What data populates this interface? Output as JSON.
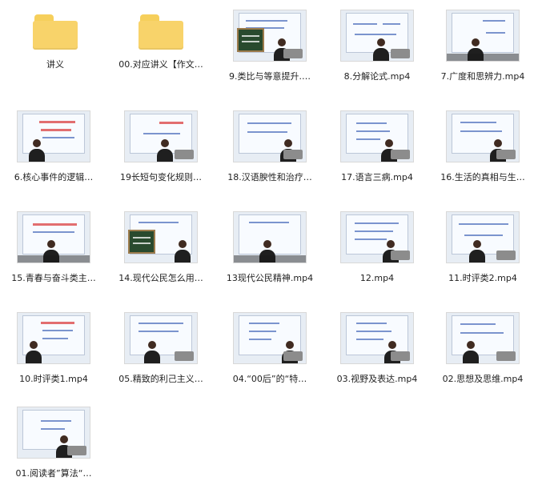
{
  "grid": {
    "items": [
      {
        "label": "讲义",
        "type": "folder",
        "icon": "folder-icon"
      },
      {
        "label": "00.对应讲义【作文…",
        "type": "folder",
        "icon": "folder-icon"
      },
      {
        "label": "9.类比与等意提升.…",
        "type": "video",
        "icon": "video-thumbnail"
      },
      {
        "label": "8.分解论式.mp4",
        "type": "video",
        "icon": "video-thumbnail"
      },
      {
        "label": "7.广度和思辨力.mp4",
        "type": "video",
        "icon": "video-thumbnail"
      },
      {
        "label": "6.核心事件的逻辑…",
        "type": "video",
        "icon": "video-thumbnail"
      },
      {
        "label": "19长短句变化规则…",
        "type": "video",
        "icon": "video-thumbnail"
      },
      {
        "label": "18.汉语腴性和治疗…",
        "type": "video",
        "icon": "video-thumbnail"
      },
      {
        "label": "17.语言三病.mp4",
        "type": "video",
        "icon": "video-thumbnail"
      },
      {
        "label": "16.生活的真相与生…",
        "type": "video",
        "icon": "video-thumbnail"
      },
      {
        "label": "15.青春与奋斗类主…",
        "type": "video",
        "icon": "video-thumbnail"
      },
      {
        "label": "14.现代公民怎么用…",
        "type": "video",
        "icon": "video-thumbnail"
      },
      {
        "label": "13现代公民精神.mp4",
        "type": "video",
        "icon": "video-thumbnail"
      },
      {
        "label": "12.mp4",
        "type": "video",
        "icon": "video-thumbnail"
      },
      {
        "label": "11.时评类2.mp4",
        "type": "video",
        "icon": "video-thumbnail"
      },
      {
        "label": "10.时评类1.mp4",
        "type": "video",
        "icon": "video-thumbnail"
      },
      {
        "label": "05.精致的利己主义…",
        "type": "video",
        "icon": "video-thumbnail"
      },
      {
        "label": "04.“00后”的“特…",
        "type": "video",
        "icon": "video-thumbnail"
      },
      {
        "label": "03.视野及表达.mp4",
        "type": "video",
        "icon": "video-thumbnail"
      },
      {
        "label": "02.思想及思维.mp4",
        "type": "video",
        "icon": "video-thumbnail"
      },
      {
        "label": "01.阅读者”算法“…",
        "type": "video",
        "icon": "video-thumbnail"
      }
    ]
  },
  "theme": {
    "folder_color": "#f8d36a",
    "screen_line_color": "#5272bd",
    "highlight_color": "#dc4b4b"
  }
}
